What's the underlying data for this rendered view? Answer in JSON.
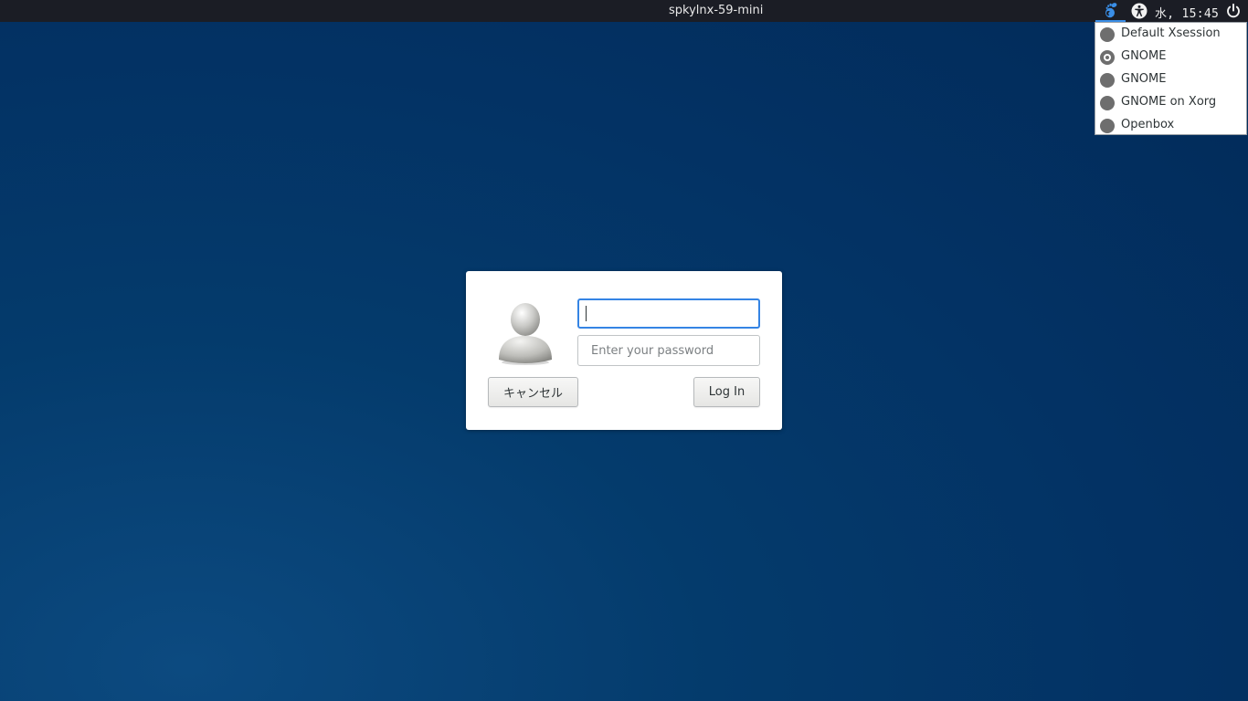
{
  "top_panel": {
    "hostname": "spkylnx-59-mini",
    "clock": "水, 15:45",
    "session_icon": "gnome-foot-icon",
    "accessibility_icon": "accessibility-icon",
    "power_icon": "power-icon",
    "accent_color": "#3a8ee6"
  },
  "session_menu": {
    "items": [
      {
        "label": "Default Xsession",
        "selected": false
      },
      {
        "label": "GNOME",
        "selected": true
      },
      {
        "label": "GNOME",
        "selected": false
      },
      {
        "label": "GNOME on Xorg",
        "selected": false
      },
      {
        "label": "Openbox",
        "selected": false
      }
    ]
  },
  "login_dialog": {
    "avatar_icon": "user-avatar-icon",
    "username_value": "",
    "password_placeholder": "Enter your password",
    "cancel_label": "キャンセル",
    "login_label": "Log In",
    "focus_color": "#3584e4"
  },
  "background_color": "#033264"
}
